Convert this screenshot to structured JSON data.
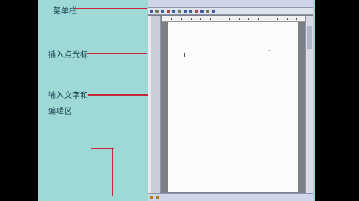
{
  "annotations": {
    "menubar": "菜单栏",
    "cursor": "插入点光标",
    "edit_line1": "输入文字和",
    "edit_line2": "编辑区"
  },
  "colors": {
    "slide_background": "#9fd9d6",
    "pointer": "#c4283a",
    "label_text": "#143a4a"
  },
  "icons": [
    "toolbar-button-icon",
    "view-button-icon"
  ]
}
